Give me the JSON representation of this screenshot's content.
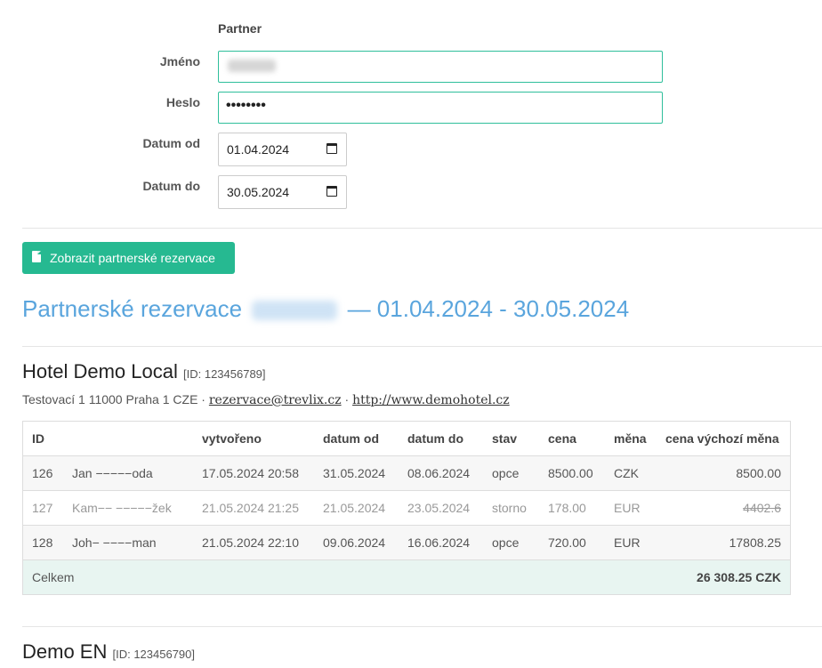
{
  "form": {
    "title": "Partner",
    "name_label": "Jméno",
    "password_label": "Heslo",
    "password_mask": "••••••••",
    "date_from_label": "Datum od",
    "date_from_value": "01.04.2024",
    "date_to_label": "Datum do",
    "date_to_value": "30.05.2024",
    "submit_label": "Zobrazit partnerské rezervace",
    "accent_color": "#26b991"
  },
  "report": {
    "heading_prefix": "Partnerské rezervace",
    "heading_suffix": "— 01.04.2024 - 30.05.2024"
  },
  "hotel1": {
    "name": "Hotel Demo Local",
    "id_label": "[ID: 123456789]",
    "address": "Testovací 1 11000 Praha 1 CZE · ",
    "email": "rezervace@trevlix.cz",
    "separator": " · ",
    "web": "http://www.demohotel.cz",
    "columns": [
      "ID",
      "",
      "vytvořeno",
      "datum od",
      "datum do",
      "stav",
      "cena",
      "měna",
      "cena výchozí měna"
    ],
    "rows": [
      {
        "id": "126",
        "guest": "Jan −−−−−oda",
        "created": "17.05.2024 20:58",
        "from": "31.05.2024",
        "to": "08.06.2024",
        "status": "opce",
        "price": "8500.00",
        "currency": "CZK",
        "default_price": "8500.00"
      },
      {
        "id": "127",
        "guest": "Kam−− −−−−−žek",
        "created": "21.05.2024 21:25",
        "from": "21.05.2024",
        "to": "23.05.2024",
        "status": "storno",
        "price": "178.00",
        "currency": "EUR",
        "default_price": "4402.6"
      },
      {
        "id": "128",
        "guest": "Joh− −−−−man",
        "created": "21.05.2024 22:10",
        "from": "09.06.2024",
        "to": "16.06.2024",
        "status": "opce",
        "price": "720.00",
        "currency": "EUR",
        "default_price": "17808.25"
      }
    ],
    "total_label": "Celkem",
    "total_value": "26 308.25 CZK"
  },
  "hotel2": {
    "name": "Demo EN",
    "id_label": "[ID: 123456790]"
  }
}
